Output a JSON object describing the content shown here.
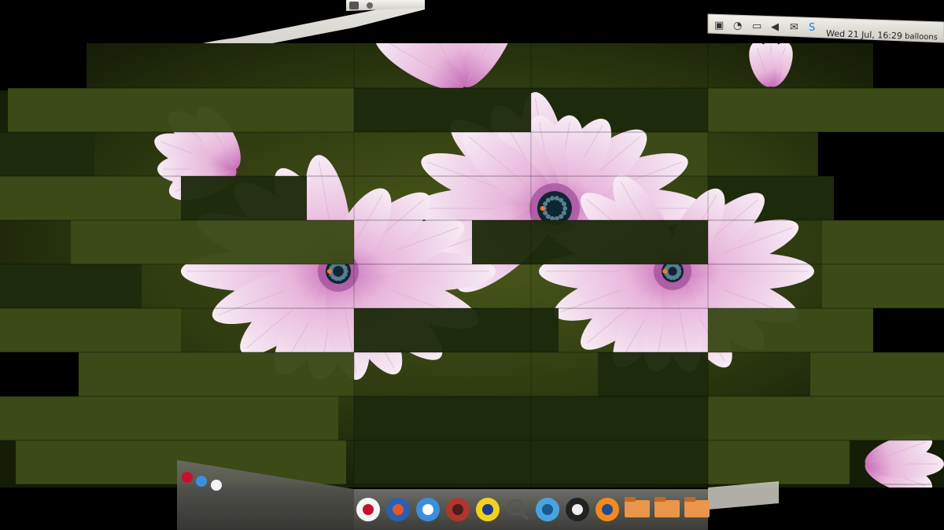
{
  "desktop": {
    "effect": "desktop-cube-glitch",
    "wallpaper": "pink-osteospermum-daisies",
    "colors": {
      "background": "#000000",
      "leaf_dark": "#1e2a0c",
      "leaf_mid": "#3b4a17",
      "leaf_light": "#56631f",
      "petal_light": "#f3e1ef",
      "petal_pink": "#e2a6d6",
      "petal_deep": "#a04c98",
      "flower_center": "#0e2533",
      "panel": "#e9e7e2"
    }
  },
  "top_panel": {
    "clock": "Wed 21 Jul, 16:29",
    "user": "balloons",
    "icons": [
      "dropbox-icon",
      "network-icon",
      "battery-icon",
      "volume-icon",
      "mail-icon",
      "skype-icon"
    ]
  },
  "dock": {
    "items": [
      "debian-icon",
      "tools-icon",
      "media-player-icon",
      "screenshot-icon",
      "audio-headphones-icon",
      "search-icon",
      "web-browser-icon",
      "inkscape-icon",
      "blender-icon",
      "folder-icon",
      "folder-icon",
      "folder-icon"
    ]
  }
}
